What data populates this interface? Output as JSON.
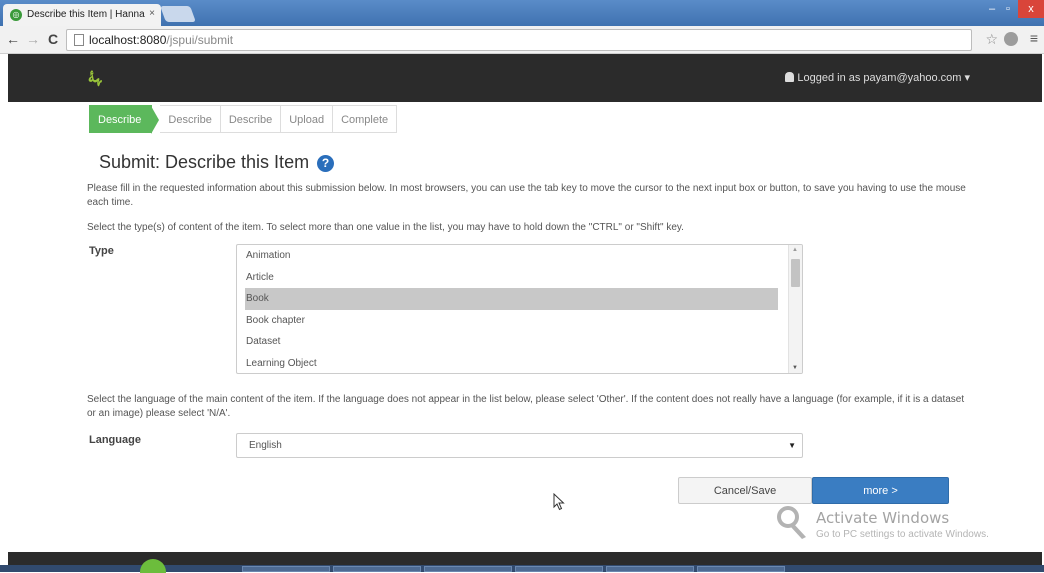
{
  "browser": {
    "tab_title": "Describe this Item | Hanna",
    "tab_close": "×",
    "url_host": "localhost:8080",
    "url_path": "/jspui/submit",
    "nav_back": "←",
    "nav_forward": "→",
    "nav_reload": "C",
    "window_min": "–",
    "window_max": "▫",
    "window_close": "x"
  },
  "header": {
    "logo_text": "ﮩﮥ",
    "login_text": "Logged in as payam@yahoo.com ▾"
  },
  "steps": [
    "Describe",
    "Describe",
    "Describe",
    "Upload",
    "Complete"
  ],
  "page": {
    "title": "Submit: Describe this Item",
    "help_glyph": "?",
    "intro": "Please fill in the requested information about this submission below. In most browsers, you can use the tab key to move the cursor to the next input box or button, to save you having to use the mouse each time.",
    "type_instructions": "Select the type(s) of content of the item. To select more than one value in the list, you may have to hold down the \"CTRL\" or \"Shift\" key.",
    "type_label": "Type",
    "type_options": [
      "Animation",
      "Article",
      "Book",
      "Book chapter",
      "Dataset",
      "Learning Object"
    ],
    "type_selected": "Book",
    "language_instructions": "Select the language of the main content of the item. If the language does not appear in the list below, please select 'Other'. If the content does not really have a language (for example, if it is a dataset or an image) please select 'N/A'.",
    "language_label": "Language",
    "language_value": "English"
  },
  "actions": {
    "cancel_label": "Cancel/Save",
    "next_label": "more >"
  },
  "watermark": {
    "title": "Activate Windows",
    "subtitle": "Go to PC settings to activate Windows."
  },
  "colors": {
    "active_step": "#5cb85c",
    "primary_button": "#3a7dc2",
    "header_bg": "#2b2b2b"
  }
}
